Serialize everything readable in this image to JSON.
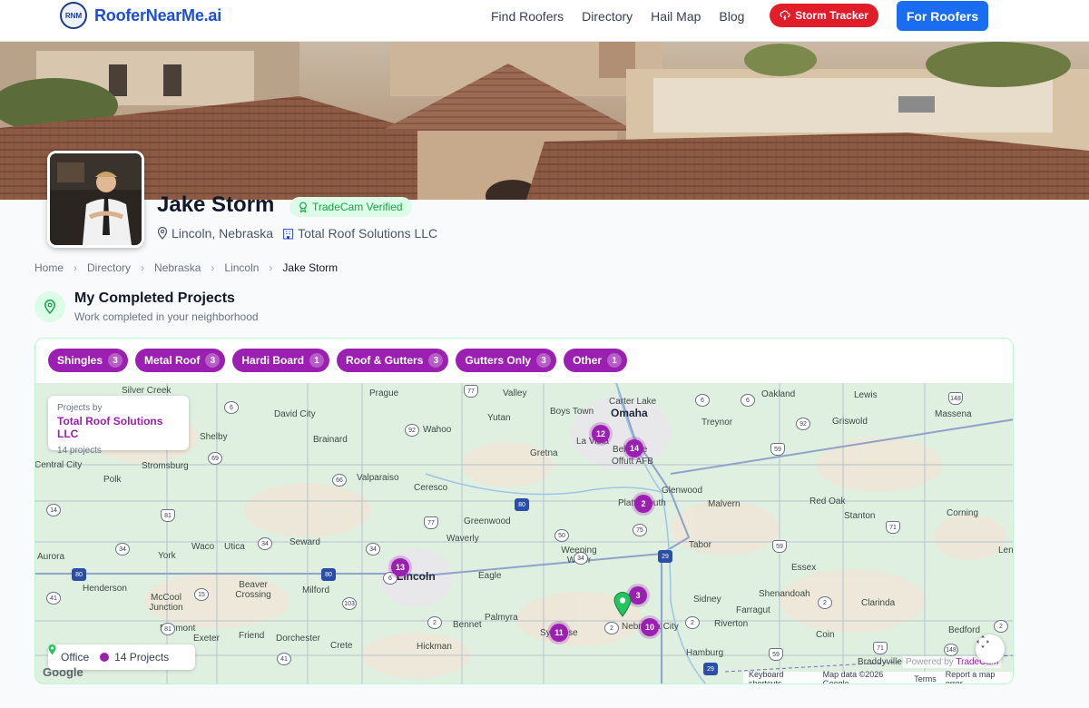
{
  "header": {
    "logo_text": "RooferNearMe.ai",
    "logo_badge": "RNM",
    "nav": [
      "Find Roofers",
      "Directory",
      "Hail Map",
      "Blog"
    ],
    "storm_tracker": "Storm Tracker",
    "for_roofers": "For Roofers"
  },
  "profile": {
    "name": "Jake Storm",
    "verified_badge": "TradeCam Verified",
    "location": "Lincoln, Nebraska",
    "company": "Total Roof Solutions LLC"
  },
  "breadcrumb": [
    "Home",
    "Directory",
    "Nebraska",
    "Lincoln",
    "Jake Storm"
  ],
  "section": {
    "title": "My Completed Projects",
    "subtitle": "Work completed in your neighborhood"
  },
  "filters": [
    {
      "label": "Shingles",
      "count": "3"
    },
    {
      "label": "Metal Roof",
      "count": "3"
    },
    {
      "label": "Hardi Board",
      "count": "1"
    },
    {
      "label": "Roof & Gutters",
      "count": "3"
    },
    {
      "label": "Gutters Only",
      "count": "3"
    },
    {
      "label": "Other",
      "count": "1"
    }
  ],
  "map": {
    "projects_by_label": "Projects by",
    "company": "Total Roof Solutions LLC",
    "projects_count": "14 projects",
    "legend": {
      "office": "Office",
      "projects": "14 Projects"
    },
    "clusters": [
      "12",
      "14",
      "2",
      "13",
      "3",
      "11",
      "10"
    ],
    "powered_by": "Powered by",
    "powered_brand": "TradeCam",
    "google": "Google",
    "attribution": [
      "Keyboard shortcuts",
      "Map data ©2026 Google",
      "Terms",
      "Report a map error"
    ],
    "places": [
      "Silver Creek",
      "Prague",
      "Valley",
      "Oakland",
      "Lewis",
      "Carter Lake",
      "Omaha",
      "Boys Town",
      "Yutan",
      "Treynor",
      "Griswold",
      "Massena",
      "David City",
      "Wahoo",
      "Shelby",
      "Brainard",
      "La Vista",
      "Bellevue",
      "Offutt AFB",
      "Central City",
      "Stromsburg",
      "Valparaiso",
      "Gretna",
      "Ceresco",
      "Glenwood",
      "Polk",
      "Plattsmouth",
      "Malvern",
      "Red Oak",
      "Stanton",
      "Corning",
      "Greenwood",
      "Waverly",
      "Aurora",
      "York",
      "Waco",
      "Utica",
      "Seward",
      "Tabor",
      "Lincoln",
      "Eagle",
      "Weeping Water",
      "Essex",
      "Henderson",
      "Beaver Crossing",
      "Milford",
      "Sidney",
      "Shenandoah",
      "Clarinda",
      "McCool Junction",
      "Fairmont",
      "Exeter",
      "Friend",
      "Dorchester",
      "Crete",
      "Bennet",
      "Palmyra",
      "Syracuse",
      "Nebraska City",
      "Riverton",
      "Farragut",
      "Hickman",
      "Hamburg",
      "Coin",
      "Bedford",
      "Braddyville",
      "Lenox"
    ]
  },
  "colors": {
    "brand": "#1d4ed8",
    "storm": "#e11d2a",
    "cta": "#1a6cf0",
    "accent": "#9b1fb0",
    "verified": "#16a34a"
  }
}
